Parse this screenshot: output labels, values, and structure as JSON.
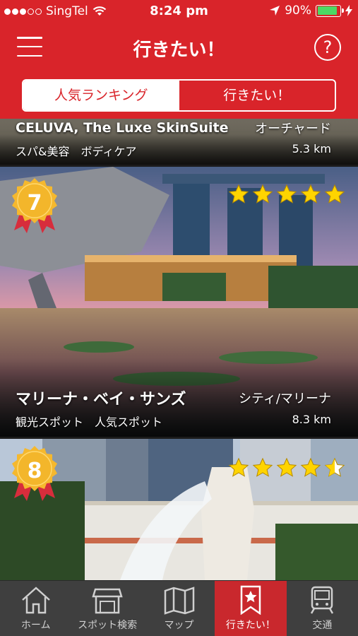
{
  "status": {
    "carrier": "SingTel",
    "time": "8:24 pm",
    "battery": "90%",
    "battery_level": 0.9
  },
  "header": {
    "title": "行きたい！",
    "menu_icon": "hamburger-icon",
    "help_icon": "question-icon"
  },
  "segments": [
    "人気ランキング",
    "行きたい！"
  ],
  "cards": [
    {
      "name": "CELUVA, The Luxe SkinSuite",
      "area": "オーチャード",
      "categories": "スパ&美容　ボディケア",
      "distance": "5.3 km"
    },
    {
      "rank": "7",
      "name": "マリーナ・ベイ・サンズ",
      "area": "シティ/マリーナ",
      "categories": "観光スポット　人気スポット",
      "distance": "8.3 km",
      "rating": 5
    },
    {
      "rank": "8",
      "rating": 4.5
    }
  ],
  "tabs": [
    {
      "label": "ホーム",
      "icon": "home-icon"
    },
    {
      "label": "スポット検索",
      "icon": "shop-icon"
    },
    {
      "label": "マップ",
      "icon": "map-icon"
    },
    {
      "label": "行きたい！",
      "icon": "bookmark-star-icon"
    },
    {
      "label": "交通",
      "icon": "train-icon"
    }
  ],
  "colors": {
    "brand": "#d9242a",
    "star": "#ffd400",
    "badge": "#f5b82e",
    "tab_active": "#c9282d"
  }
}
